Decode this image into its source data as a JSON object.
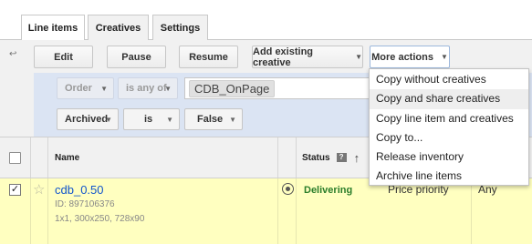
{
  "tabs": [
    {
      "label": "Line items",
      "active": true
    },
    {
      "label": "Creatives",
      "active": false
    },
    {
      "label": "Settings",
      "active": false
    }
  ],
  "toolbar": {
    "edit": "Edit",
    "pause": "Pause",
    "resume": "Resume",
    "add_existing": "Add existing creative",
    "more_actions": "More actions"
  },
  "filters": {
    "row1": {
      "field": "Order",
      "op": "is any of",
      "value": "CDB_OnPage"
    },
    "row2": {
      "field": "Archived",
      "op": "is",
      "value": "False"
    }
  },
  "menu": {
    "items": [
      "Copy without creatives",
      "Copy and share creatives",
      "Copy line item and creatives",
      "Copy to...",
      "Release inventory",
      "Archive line items"
    ],
    "hovered_index": 1
  },
  "table": {
    "headers": {
      "name": "Name",
      "status": "Status"
    },
    "rows": [
      {
        "name": "cdb_0.50",
        "id": "ID: 897106376",
        "sizes": "1x1, 300x250, 728x90",
        "status": "Delivering",
        "priority": "Price priority",
        "extra": "Any",
        "checked": true
      }
    ]
  },
  "colors": {
    "accent_blue": "#dbe4f3",
    "row_highlight": "#ffffc0",
    "link": "#1155cc",
    "delivering": "#2a7d2a"
  }
}
